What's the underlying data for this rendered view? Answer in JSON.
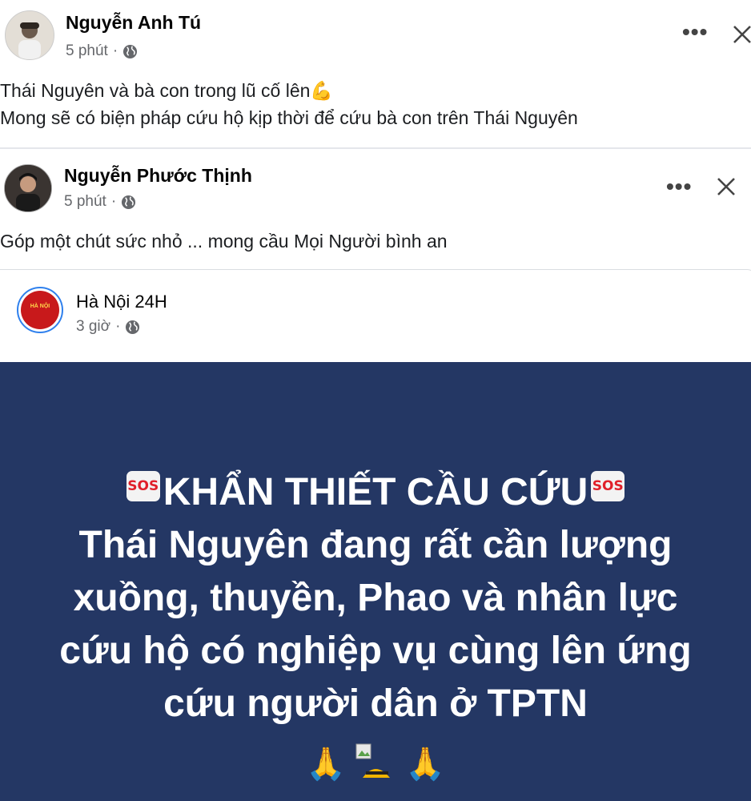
{
  "posts": [
    {
      "author": "Nguyễn Anh Tú",
      "time": "5 phút",
      "line1": "Thái Nguyên và bà con trong lũ cố lên💪",
      "line2": "Mong sẽ có biện pháp cứu hộ kịp thời để cứu bà con trên Thái Nguyên",
      "more_label": "•••",
      "close_icon": "close-icon"
    },
    {
      "author": "Nguyễn Phước Thịnh",
      "time": "5 phút",
      "line1": "Góp một chút sức nhỏ ... mong cầu Mọi Người bình an",
      "more_label": "•••",
      "close_icon": "close-icon"
    }
  ],
  "shared": {
    "page_name": "Hà Nội 24H",
    "time": "3 giờ",
    "avatar_text": "HÀ NỘI",
    "banner_color": "#243764",
    "banner": {
      "sos_label": "SOS",
      "heading": "KHẨN THIẾT CẦU CỨU",
      "line2": "Thái Nguyên đang rất cần lượng",
      "line3": "xuồng, thuyền, Phao và nhân lực",
      "line4": "cứu hộ có nghiệp vụ cùng lên ứng",
      "line5": "cứu người dân ở TPTN",
      "emoji": "🙏"
    }
  },
  "separator": "·",
  "colors": {
    "meta": "#65676b",
    "divider": "#e4e6eb",
    "avatar_red": "#c8191b"
  }
}
